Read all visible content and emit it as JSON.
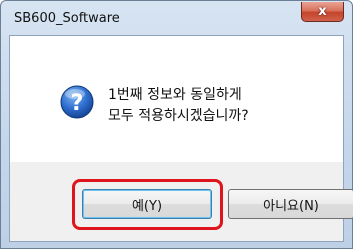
{
  "window": {
    "title": "SB600_Software",
    "close_glyph": "x"
  },
  "dialog": {
    "icon": "question-icon",
    "message_line1": "1번째 정보와 동일하게",
    "message_line2": "모두 적용하시겠습니까?"
  },
  "buttons": {
    "yes_label": "예(Y)",
    "no_label": "아니요(N)"
  },
  "colors": {
    "highlight": "#e0141c",
    "icon_blue": "#1f5fbf",
    "close_red": "#c4442b"
  }
}
